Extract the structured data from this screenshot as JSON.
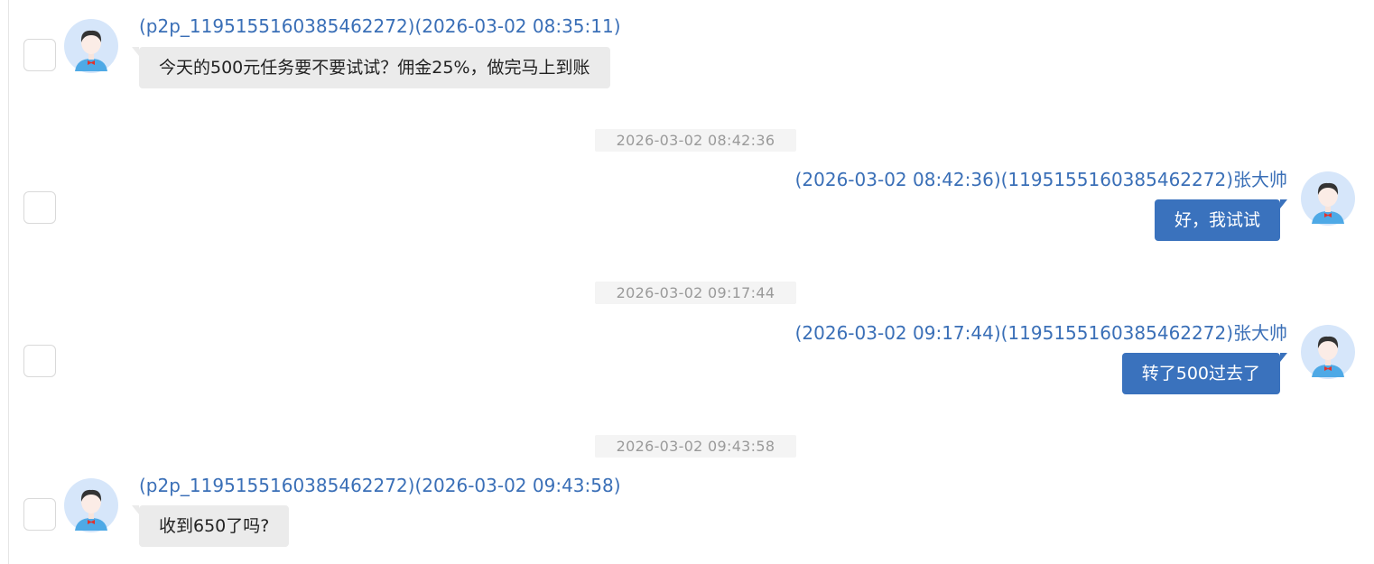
{
  "messages": [
    {
      "meta": "(p2p_1195155160385462272)(2026-03-02 08:35:11)",
      "text": "今天的500元任务要不要试试？佣金25%，做完马上到账"
    },
    {
      "divider": "2026-03-02 08:42:36",
      "meta": "(2026-03-02 08:42:36)(1195155160385462272)张大帅",
      "text": "好，我试试"
    },
    {
      "divider": "2026-03-02 09:17:44",
      "meta": "(2026-03-02 09:17:44)(1195155160385462272)张大帅",
      "text": "转了500过去了"
    },
    {
      "divider": "2026-03-02 09:43:58",
      "meta": "(p2p_1195155160385462272)(2026-03-02 09:43:58)",
      "text": "收到650了吗?"
    }
  ],
  "colors": {
    "meta_text": "#3a6fb7",
    "outgoing_bubble": "#3a72bd",
    "incoming_bubble": "#ebebeb",
    "timestamp_text": "#9a9a9a"
  },
  "icons": {
    "avatar": "user-avatar-icon"
  }
}
